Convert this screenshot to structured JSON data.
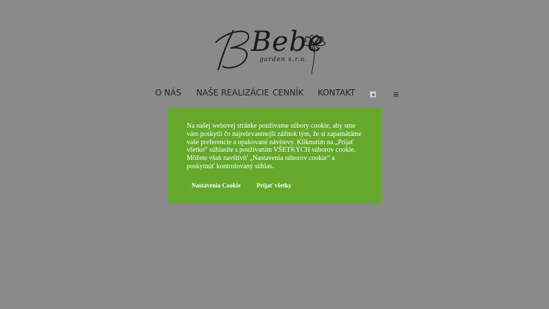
{
  "logo": {
    "name": "Bebe",
    "tagline": "garden s.r.o."
  },
  "nav": {
    "items": [
      {
        "label": "O NÁS"
      },
      {
        "label": "NAŠE REALIZÁCIE"
      },
      {
        "label": "CENNÍK"
      },
      {
        "label": "KONTAKT"
      }
    ],
    "menu_icon": "≡"
  },
  "cookie": {
    "text": "Na našej webovej stránke používame súbory cookie, aby sme vám poskytli čo najrelevantnejší zážitok tým, že si zapamätáme vaše preferencie a opakované návštevy. Kliknutím na „Prijať všetko“ súhlasíte s používaním VŠETKÝCH súborov cookie. Môžete však navštíviť „Nastavenia súborov cookie“ a poskytnúť kontrolovaný súhlas.",
    "settings_label": "Nastavenia Cookie",
    "accept_label": "Prijať všetky"
  },
  "colors": {
    "background": "#8a8a8a",
    "cookie_bg": "#65a82c",
    "nav_text": "#222222"
  }
}
